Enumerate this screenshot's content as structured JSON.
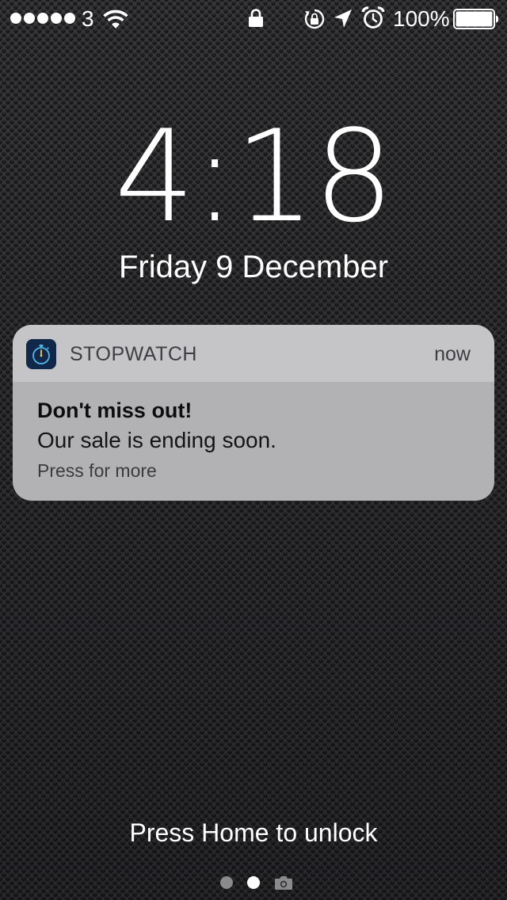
{
  "status_bar": {
    "carrier": "3",
    "signal_bars": 5,
    "battery_percent": "100%",
    "battery_level": 1.0,
    "icons": [
      "wifi-icon",
      "lock-icon",
      "rotation-lock-icon",
      "location-icon",
      "alarm-icon",
      "battery-icon"
    ]
  },
  "lock_screen": {
    "time": "4:18",
    "date": "Friday 9 December",
    "unlock_prompt": "Press Home to unlock"
  },
  "notification": {
    "app_name": "STOPWATCH",
    "app_icon": "stopwatch-icon",
    "time": "now",
    "title": "Don't miss out!",
    "body": "Our sale is ending soon.",
    "hint": "Press for more"
  },
  "page_indicator": {
    "pages": 2,
    "active_page": 2,
    "trailing_icon": "camera-icon"
  },
  "colors": {
    "background": "#2e2e31",
    "notification_header": "#c5c4c7",
    "notification_body": "#b2b1b4",
    "app_icon_bg": "#11284a",
    "app_icon_accent": "#4fb8e6"
  }
}
